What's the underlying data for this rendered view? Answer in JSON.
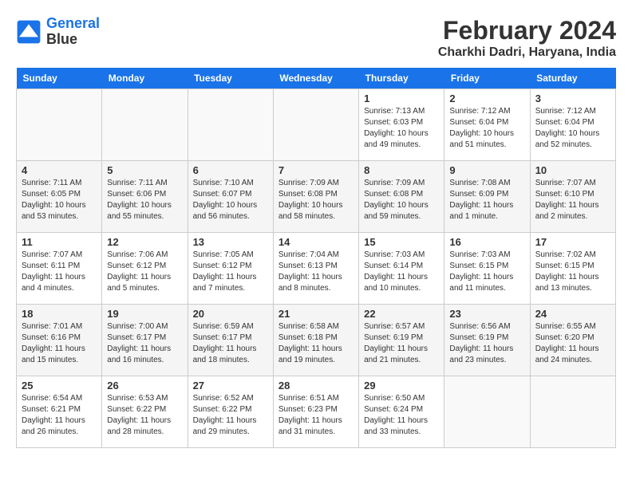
{
  "header": {
    "logo_line1": "General",
    "logo_line2": "Blue",
    "title": "February 2024",
    "subtitle": "Charkhi Dadri, Haryana, India"
  },
  "days_of_week": [
    "Sunday",
    "Monday",
    "Tuesday",
    "Wednesday",
    "Thursday",
    "Friday",
    "Saturday"
  ],
  "weeks": [
    [
      {
        "day": "",
        "empty": true
      },
      {
        "day": "",
        "empty": true
      },
      {
        "day": "",
        "empty": true
      },
      {
        "day": "",
        "empty": true
      },
      {
        "day": "1",
        "sunrise": "7:13 AM",
        "sunset": "6:03 PM",
        "daylight": "10 hours and 49 minutes."
      },
      {
        "day": "2",
        "sunrise": "7:12 AM",
        "sunset": "6:04 PM",
        "daylight": "10 hours and 51 minutes."
      },
      {
        "day": "3",
        "sunrise": "7:12 AM",
        "sunset": "6:04 PM",
        "daylight": "10 hours and 52 minutes."
      }
    ],
    [
      {
        "day": "4",
        "sunrise": "7:11 AM",
        "sunset": "6:05 PM",
        "daylight": "10 hours and 53 minutes."
      },
      {
        "day": "5",
        "sunrise": "7:11 AM",
        "sunset": "6:06 PM",
        "daylight": "10 hours and 55 minutes."
      },
      {
        "day": "6",
        "sunrise": "7:10 AM",
        "sunset": "6:07 PM",
        "daylight": "10 hours and 56 minutes."
      },
      {
        "day": "7",
        "sunrise": "7:09 AM",
        "sunset": "6:08 PM",
        "daylight": "10 hours and 58 minutes."
      },
      {
        "day": "8",
        "sunrise": "7:09 AM",
        "sunset": "6:08 PM",
        "daylight": "10 hours and 59 minutes."
      },
      {
        "day": "9",
        "sunrise": "7:08 AM",
        "sunset": "6:09 PM",
        "daylight": "11 hours and 1 minute."
      },
      {
        "day": "10",
        "sunrise": "7:07 AM",
        "sunset": "6:10 PM",
        "daylight": "11 hours and 2 minutes."
      }
    ],
    [
      {
        "day": "11",
        "sunrise": "7:07 AM",
        "sunset": "6:11 PM",
        "daylight": "11 hours and 4 minutes."
      },
      {
        "day": "12",
        "sunrise": "7:06 AM",
        "sunset": "6:12 PM",
        "daylight": "11 hours and 5 minutes."
      },
      {
        "day": "13",
        "sunrise": "7:05 AM",
        "sunset": "6:12 PM",
        "daylight": "11 hours and 7 minutes."
      },
      {
        "day": "14",
        "sunrise": "7:04 AM",
        "sunset": "6:13 PM",
        "daylight": "11 hours and 8 minutes."
      },
      {
        "day": "15",
        "sunrise": "7:03 AM",
        "sunset": "6:14 PM",
        "daylight": "11 hours and 10 minutes."
      },
      {
        "day": "16",
        "sunrise": "7:03 AM",
        "sunset": "6:15 PM",
        "daylight": "11 hours and 11 minutes."
      },
      {
        "day": "17",
        "sunrise": "7:02 AM",
        "sunset": "6:15 PM",
        "daylight": "11 hours and 13 minutes."
      }
    ],
    [
      {
        "day": "18",
        "sunrise": "7:01 AM",
        "sunset": "6:16 PM",
        "daylight": "11 hours and 15 minutes."
      },
      {
        "day": "19",
        "sunrise": "7:00 AM",
        "sunset": "6:17 PM",
        "daylight": "11 hours and 16 minutes."
      },
      {
        "day": "20",
        "sunrise": "6:59 AM",
        "sunset": "6:17 PM",
        "daylight": "11 hours and 18 minutes."
      },
      {
        "day": "21",
        "sunrise": "6:58 AM",
        "sunset": "6:18 PM",
        "daylight": "11 hours and 19 minutes."
      },
      {
        "day": "22",
        "sunrise": "6:57 AM",
        "sunset": "6:19 PM",
        "daylight": "11 hours and 21 minutes."
      },
      {
        "day": "23",
        "sunrise": "6:56 AM",
        "sunset": "6:19 PM",
        "daylight": "11 hours and 23 minutes."
      },
      {
        "day": "24",
        "sunrise": "6:55 AM",
        "sunset": "6:20 PM",
        "daylight": "11 hours and 24 minutes."
      }
    ],
    [
      {
        "day": "25",
        "sunrise": "6:54 AM",
        "sunset": "6:21 PM",
        "daylight": "11 hours and 26 minutes."
      },
      {
        "day": "26",
        "sunrise": "6:53 AM",
        "sunset": "6:22 PM",
        "daylight": "11 hours and 28 minutes."
      },
      {
        "day": "27",
        "sunrise": "6:52 AM",
        "sunset": "6:22 PM",
        "daylight": "11 hours and 29 minutes."
      },
      {
        "day": "28",
        "sunrise": "6:51 AM",
        "sunset": "6:23 PM",
        "daylight": "11 hours and 31 minutes."
      },
      {
        "day": "29",
        "sunrise": "6:50 AM",
        "sunset": "6:24 PM",
        "daylight": "11 hours and 33 minutes."
      },
      {
        "day": "",
        "empty": true
      },
      {
        "day": "",
        "empty": true
      }
    ]
  ]
}
